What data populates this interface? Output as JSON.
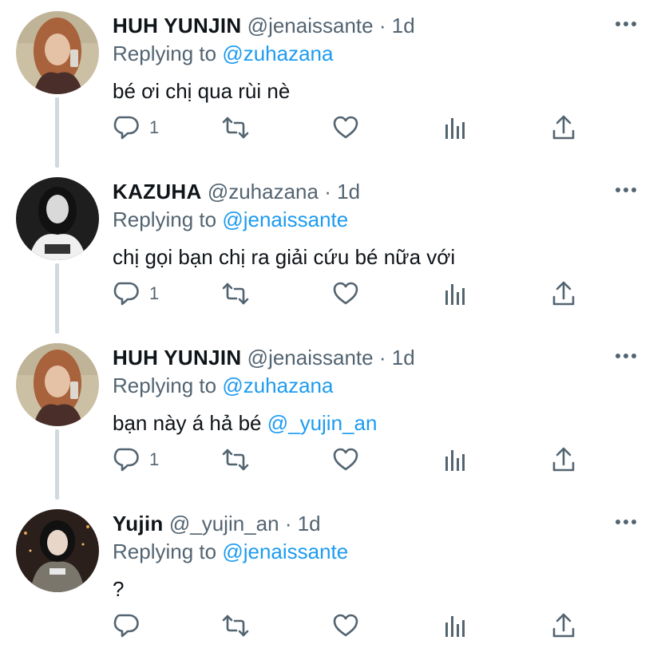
{
  "colors": {
    "accent": "#1d9bf0",
    "muted": "#536471",
    "text": "#0f1419",
    "thread_line": "#cfd9de"
  },
  "replying_prefix": "Replying to",
  "tweets": [
    {
      "name": "HUH YUNJIN",
      "handle": "@jenaissante",
      "dot": "·",
      "time": "1d",
      "replying_to": "@zuhazana",
      "text": "bé ơi chị qua rùi nè",
      "text_mention": "",
      "reply_count": "1",
      "avatar": "avatar-hair-brown"
    },
    {
      "name": "KAZUHA",
      "handle": "@zuhazana",
      "dot": "·",
      "time": "1d",
      "replying_to": "@jenaissante",
      "text": "chị gọi bạn chị ra giải cứu bé nữa với",
      "text_mention": "",
      "reply_count": "1",
      "avatar": "avatar-monochrome"
    },
    {
      "name": "HUH YUNJIN",
      "handle": "@jenaissante",
      "dot": "·",
      "time": "1d",
      "replying_to": "@zuhazana",
      "text": "bạn này á hả bé ",
      "text_mention": "@_yujin_an",
      "reply_count": "1",
      "avatar": "avatar-hair-brown"
    },
    {
      "name": "Yujin",
      "handle": "@_yujin_an",
      "dot": "·",
      "time": "1d",
      "replying_to": "@jenaissante",
      "text": "?",
      "text_mention": "",
      "reply_count": "",
      "avatar": "avatar-night-city"
    }
  ],
  "icons": {
    "reply": "reply-icon",
    "retweet": "retweet-icon",
    "like": "like-icon",
    "views": "analytics-icon",
    "share": "share-icon",
    "more": "more-icon"
  }
}
